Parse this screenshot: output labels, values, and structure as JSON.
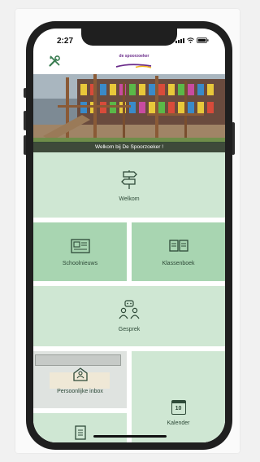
{
  "status_bar": {
    "time": "2:27"
  },
  "header": {
    "logo_text": "de spoorzoeker"
  },
  "hero": {
    "caption": "Welkom bij De Spoorzoeker !"
  },
  "tiles": [
    {
      "label": "Welkom",
      "icon": "signpost-icon"
    },
    {
      "label": "Schoolnieuws",
      "icon": "newspaper-icon"
    },
    {
      "label": "Klassenboek",
      "icon": "open-book-icon"
    },
    {
      "label": "Gesprek",
      "icon": "conversation-icon"
    },
    {
      "label": "Persoonlijke inbox",
      "icon": "inbox-icon"
    },
    {
      "label": "Kalender",
      "icon": "calendar-icon",
      "day": "10"
    }
  ],
  "colors": {
    "tile_light": "#cfe7d3",
    "tile_dark": "#a8d5b1",
    "icon_stroke": "#2e4a38",
    "brand_purple": "#6a2b8a"
  }
}
